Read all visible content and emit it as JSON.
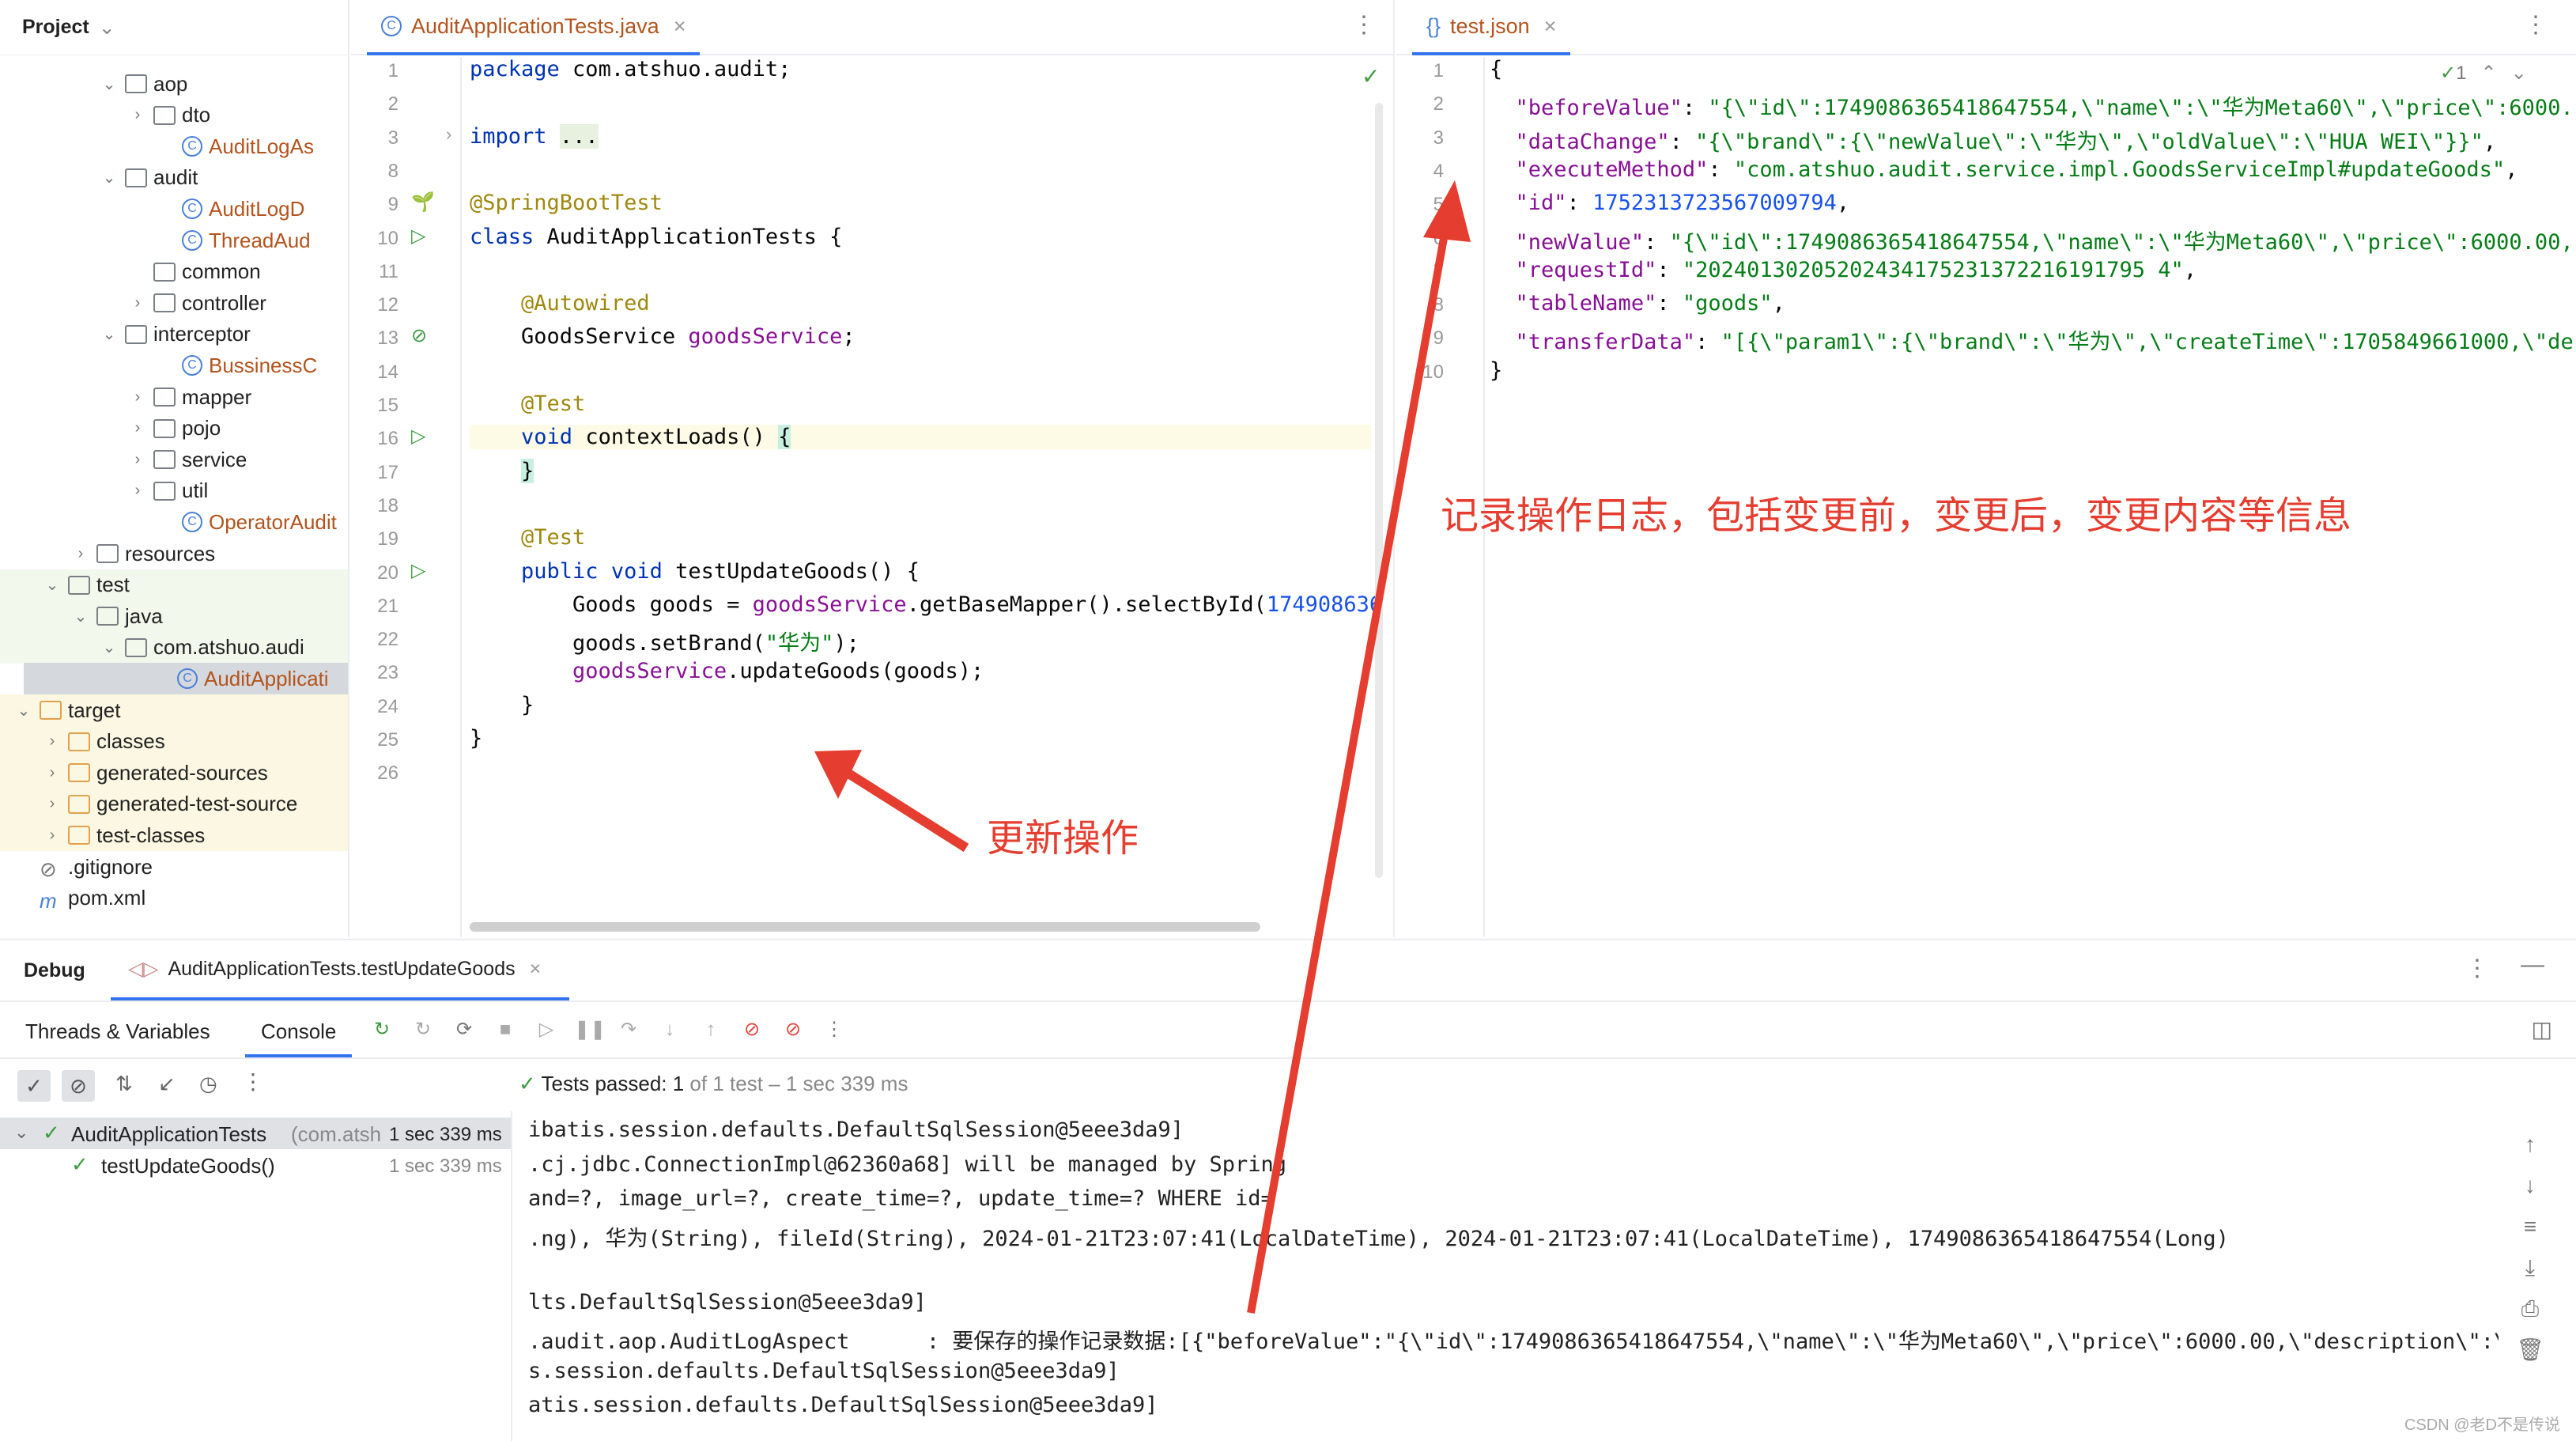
{
  "project": {
    "title": "Project",
    "tree": [
      {
        "label": "aop",
        "indent": 1,
        "type": "folder",
        "open": true
      },
      {
        "label": "dto",
        "indent": 2,
        "type": "folder",
        "open": false
      },
      {
        "label": "AuditLogAs",
        "indent": 3,
        "type": "class",
        "orange": true
      },
      {
        "label": "audit",
        "indent": 1,
        "type": "folder",
        "open": true
      },
      {
        "label": "AuditLogD",
        "indent": 3,
        "type": "class",
        "orange": true
      },
      {
        "label": "ThreadAud",
        "indent": 3,
        "type": "class",
        "orange": true
      },
      {
        "label": "common",
        "indent": 2,
        "type": "folder",
        "open": null
      },
      {
        "label": "controller",
        "indent": 2,
        "type": "folder",
        "open": false
      },
      {
        "label": "interceptor",
        "indent": 1,
        "type": "folder",
        "open": true
      },
      {
        "label": "BussinessC",
        "indent": 3,
        "type": "class",
        "orange": true
      },
      {
        "label": "mapper",
        "indent": 2,
        "type": "folder",
        "open": false
      },
      {
        "label": "pojo",
        "indent": 2,
        "type": "folder",
        "open": false
      },
      {
        "label": "service",
        "indent": 2,
        "type": "folder",
        "open": false
      },
      {
        "label": "util",
        "indent": 2,
        "type": "folder",
        "open": false
      },
      {
        "label": "OperatorAudit",
        "indent": 3,
        "type": "class",
        "orange": true
      },
      {
        "label": "resources",
        "indent": 0,
        "type": "folder",
        "open": false
      },
      {
        "label": "test",
        "indent": -1,
        "type": "folder",
        "open": true
      },
      {
        "label": "java",
        "indent": 0,
        "type": "folder",
        "open": true
      },
      {
        "label": "com.atshuo.audi",
        "indent": 1,
        "type": "folder",
        "open": true
      },
      {
        "label": "AuditApplicati",
        "indent": 2,
        "type": "class",
        "orange": true
      },
      {
        "label": "target",
        "indent": -2,
        "type": "ofolder",
        "open": true
      },
      {
        "label": "classes",
        "indent": -1,
        "type": "ofolder",
        "open": false
      },
      {
        "label": "generated-sources",
        "indent": -1,
        "type": "ofolder",
        "open": false
      },
      {
        "label": "generated-test-source",
        "indent": -1,
        "type": "ofolder",
        "open": false
      },
      {
        "label": "test-classes",
        "indent": -1,
        "type": "ofolder",
        "open": false
      },
      {
        "label": ".gitignore",
        "indent": -2,
        "type": "ignore",
        "open": null
      },
      {
        "label": "pom.xml",
        "indent": -2,
        "type": "maven",
        "open": null
      }
    ]
  },
  "editor1": {
    "tab": "AuditApplicationTests.java",
    "lines": [
      {
        "n": "1",
        "html": "<span class='kw'>package</span> com.atshuo.audit;"
      },
      {
        "n": "2",
        "html": ""
      },
      {
        "n": "3",
        "html": "<span class='kw'>import</span> <span style='background:#e8f0e0'>...</span>"
      },
      {
        "n": "8",
        "html": ""
      },
      {
        "n": "9",
        "html": "<span class='ann'>@SpringBootTest</span>"
      },
      {
        "n": "10",
        "html": "<span class='kw'>class</span> AuditApplicationTests {"
      },
      {
        "n": "11",
        "html": ""
      },
      {
        "n": "12",
        "html": "    <span class='ann'>@Autowired</span>"
      },
      {
        "n": "13",
        "html": "    GoodsService <span class='fld'>goodsService</span>;"
      },
      {
        "n": "14",
        "html": ""
      },
      {
        "n": "15",
        "html": "    <span class='ann'>@Test</span>"
      },
      {
        "n": "16",
        "html": "    <span class='kw'>void</span> contextLoads() <span style='background:#c8f0e0'>{</span>"
      },
      {
        "n": "17",
        "html": "    <span style='background:#c8f0e0'>}</span>"
      },
      {
        "n": "18",
        "html": ""
      },
      {
        "n": "19",
        "html": "    <span class='ann'>@Test</span>"
      },
      {
        "n": "20",
        "html": "    <span class='kw'>public void</span> testUpdateGoods() {"
      },
      {
        "n": "21",
        "html": "        Goods goods = <span class='fld'>goodsService</span>.getBaseMapper().selectById(<span class='num'>174908636</span>"
      },
      {
        "n": "22",
        "html": "        goods.setBrand(<span class='str'>\"华为\"</span>);"
      },
      {
        "n": "23",
        "html": "        <span class='fld'>goodsService</span>.updateGoods(goods);"
      },
      {
        "n": "24",
        "html": "    }"
      },
      {
        "n": "25",
        "html": "}"
      },
      {
        "n": "26",
        "html": ""
      }
    ]
  },
  "editor2": {
    "tab": "test.json",
    "inspect": "1",
    "lines": [
      {
        "n": "1",
        "html": "{"
      },
      {
        "n": "2",
        "html": "  <span class='key'>\"beforeValue\"</span>: <span class='str'>\"{\\\"id\\\":1749086365418647554,\\\"name\\\":\\\"华为Meta60\\\",\\\"price\\\":6000.</span>"
      },
      {
        "n": "3",
        "html": "  <span class='key'>\"dataChange\"</span>: <span class='str'>\"{\\\"brand\\\":{\\\"newValue\\\":\\\"华为\\\",\\\"oldValue\\\":\\\"HUA WEI\\\"}}\"</span>,"
      },
      {
        "n": "4",
        "html": "  <span class='key'>\"executeMethod\"</span>: <span class='str'>\"com.atshuo.audit.service.impl.GoodsServiceImpl#updateGoods\"</span>,"
      },
      {
        "n": "5",
        "html": "  <span class='key'>\"id\"</span>: <span class='num'>1752313723567009794</span>,"
      },
      {
        "n": "6",
        "html": "  <span class='key'>\"newValue\"</span>: <span class='str'>\"{\\\"id\\\":1749086365418647554,\\\"name\\\":\\\"华为Meta60\\\",\\\"price\\\":6000.00,</span>"
      },
      {
        "n": "7",
        "html": "  <span class='key'>\"requestId\"</span>: <span class='str'>\"20240130205202434175231372216191795 4\"</span>,"
      },
      {
        "n": "8",
        "html": "  <span class='key'>\"tableName\"</span>: <span class='str'>\"goods\"</span>,"
      },
      {
        "n": "9",
        "html": "  <span class='key'>\"transferData\"</span>: <span class='str'>\"[{\\\"param1\\\":{\\\"brand\\\":\\\"华为\\\",\\\"createTime\\\":1705849661000,\\\"de</span>"
      },
      {
        "n": "10",
        "html": "}"
      }
    ]
  },
  "annotations": {
    "log": "记录操作日志，包括变更前，变更后，变更内容等信息",
    "update": "更新操作"
  },
  "debug": {
    "title": "Debug",
    "session_tab": "AuditApplicationTests.testUpdateGoods",
    "tabs": [
      "Threads & Variables",
      "Console"
    ],
    "status_bold": "Tests passed: 1",
    "status_rest": " of 1 test – 1 sec 339 ms",
    "tests": [
      {
        "name": "AuditApplicationTests",
        "pkg": "(com.atsh",
        "time": "1 sec 339 ms"
      },
      {
        "name": "testUpdateGoods()",
        "time": "1 sec 339 ms"
      }
    ],
    "console": [
      "ibatis.session.defaults.DefaultSqlSession@5eee3da9]",
      ".cj.jdbc.ConnectionImpl@62360a68] will be managed by Spring",
      "and=?, image_url=?, create_time=?, update_time=? WHERE id=",
      ".ng), 华为(String), fileId(String), 2024-01-21T23:07:41(LocalDateTime), 2024-01-21T23:07:41(LocalDateTime), 1749086365418647554(Long)",
      "",
      "lts.DefaultSqlSession@5eee3da9]",
      ".audit.aop.AuditLogAspect      : 要保存的操作记录数据:[{\"beforeValue\":\"{\\\"id\\\":1749086365418647554,\\\"name\\\":\\\"华为Meta60\\\",\\\"price\\\":6000.00,\\\"description\\\":\\\"遥",
      "s.session.defaults.DefaultSqlSession@5eee3da9]",
      "atis.session.defaults.DefaultSqlSession@5eee3da9]"
    ]
  },
  "watermark": "CSDN @老D不是传说"
}
